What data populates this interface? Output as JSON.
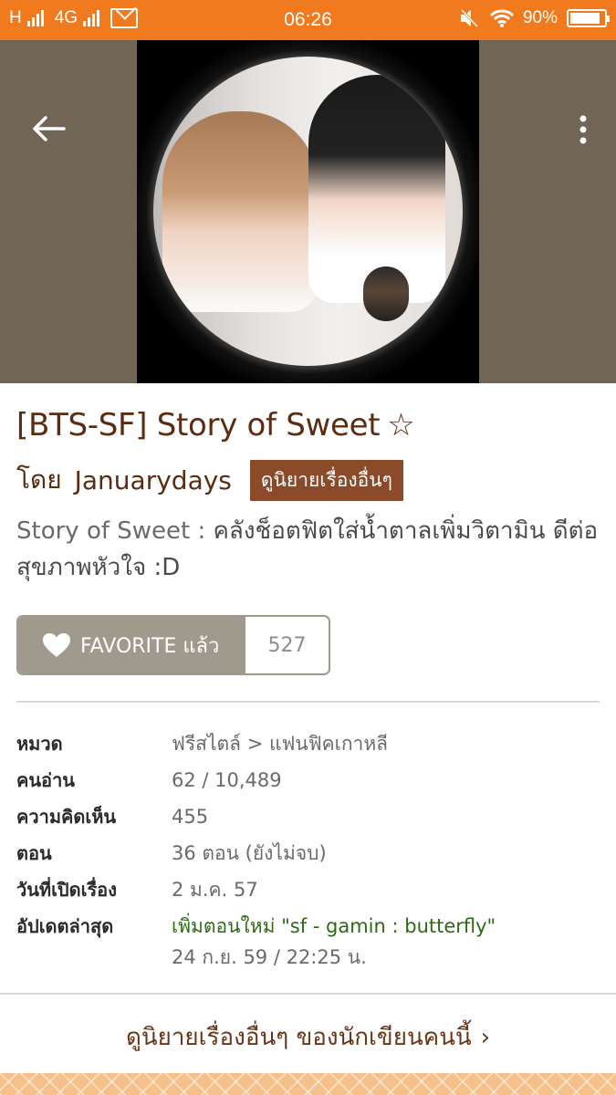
{
  "status_bar": {
    "network1": "H",
    "network2": "4G",
    "time": "06:26",
    "battery": "90%",
    "battery_level": 0.9
  },
  "cover": {
    "background_color": "#716656"
  },
  "story": {
    "title": "[BTS-SF] Story of Sweet",
    "title_star": "☆",
    "by_label": "โดย",
    "author": "Januarydays",
    "other_stories_button": "ดูนิยายเรื่องอื่นๆ",
    "description_head": "Story of Sweet :",
    "description_body": " คลังช็อตฟิตใส่น้ำตาลเพิ่มวิตามิน ดีต่อสุขภาพหัวใจ :D"
  },
  "favorite": {
    "label": "FAVORITE แล้ว",
    "count": "527"
  },
  "info": {
    "category_label": "หมวด",
    "category_value": "ฟรีสไตล์ > แฟนฟิคเกาหลี",
    "readers_label": "คนอ่าน",
    "readers_value": "62 / 10,489",
    "comments_label": "ความคิดเห็น",
    "comments_value": "455",
    "chapters_label": "ตอน",
    "chapters_value": "36 ตอน (ยังไม่จบ)",
    "opened_label": "วันที่เปิดเรื่อง",
    "opened_value": "2 ม.ค. 57",
    "updated_label": "อัปเดตล่าสุด",
    "updated_new": "เพิ่มตอนใหม่",
    "updated_chapter": " \"sf - gamin : butterfly\"",
    "updated_time": "24 ก.ย. 59 / 22:25 น."
  },
  "more_link": {
    "label": "ดูนิยายเรื่องอื่นๆ ของนักเขียนคนนี้",
    "chevron": "›"
  },
  "colors": {
    "accent": "#f07a1d",
    "title": "#5a2d12",
    "button_brown": "#8b4b2a",
    "favorite_gray": "#a0998e",
    "update_green": "#2e6a14"
  }
}
